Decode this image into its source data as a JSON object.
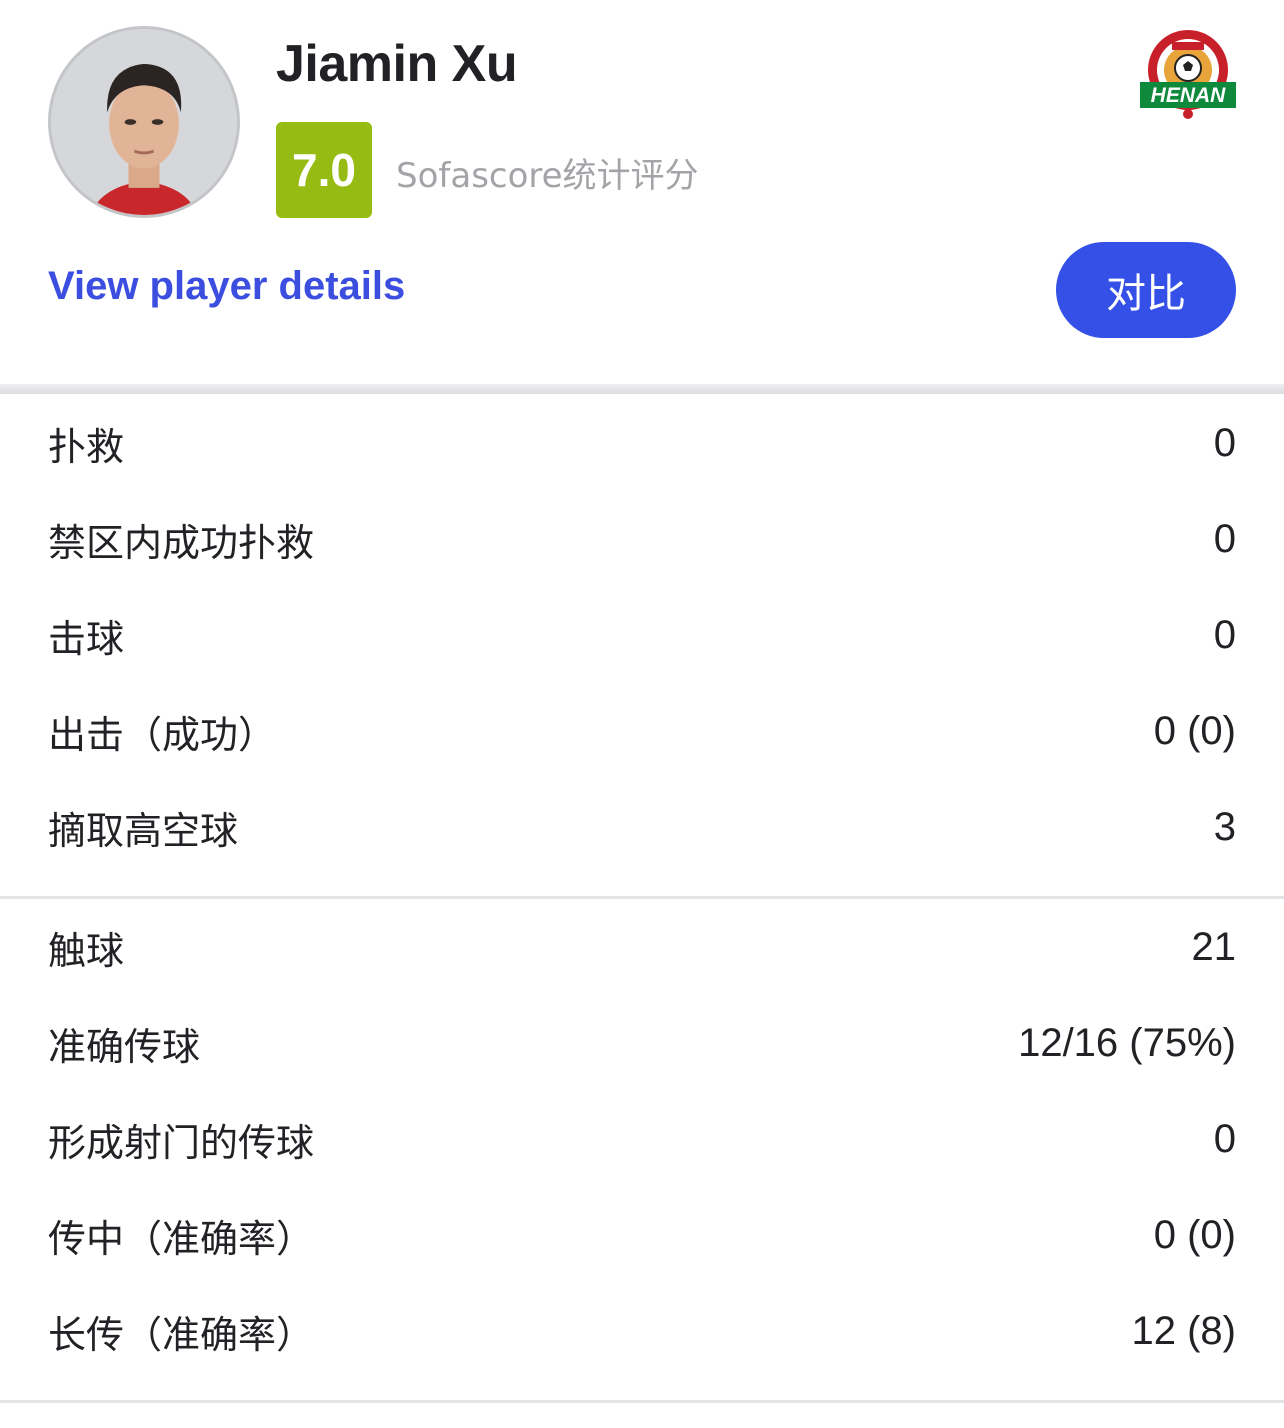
{
  "player": {
    "name": "Jiamin Xu",
    "rating": "7.0",
    "rating_label": "Sofascore统计评分",
    "rating_color": "#96bb12",
    "avatar_icon": "player-photo",
    "club_logo_icon": "henan-fc-crest",
    "club_logo_text": "HENAN"
  },
  "actions": {
    "details_link": "View player details",
    "compare_button": "对比",
    "link_color": "#3b4ee0",
    "button_color": "#3450e6"
  },
  "stats_groups": [
    {
      "rows": [
        {
          "label": "扑救",
          "value": "0"
        },
        {
          "label": "禁区内成功扑救",
          "value": "0"
        },
        {
          "label": "击球",
          "value": "0"
        },
        {
          "label": "出击（成功）",
          "value": "0 (0)"
        },
        {
          "label": "摘取高空球",
          "value": "3"
        }
      ]
    },
    {
      "rows": [
        {
          "label": "触球",
          "value": "21"
        },
        {
          "label": "准确传球",
          "value": "12/16 (75%)"
        },
        {
          "label": "形成射门的传球",
          "value": "0"
        },
        {
          "label": "传中（准确率）",
          "value": "0 (0)"
        },
        {
          "label": "长传（准确率）",
          "value": "12 (8)"
        }
      ]
    }
  ]
}
